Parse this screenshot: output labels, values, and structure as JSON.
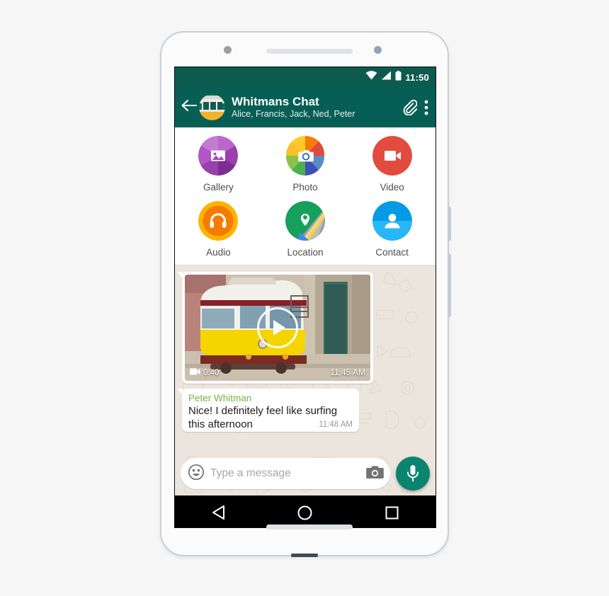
{
  "page": {
    "background_color": "#f6f6f6"
  },
  "phone": {
    "frame_color": "#fbfbfc",
    "border_color": "#c8d0d6",
    "sensor_icon": "proximity-sensor-dot",
    "earpiece_icon": "earpiece-speaker-grille",
    "camera_icon": "front-camera-lens",
    "bottom_speaker_icon": "bottom-speaker-grille",
    "usb_icon": "usb-port",
    "power_button_label": "power-button",
    "volume_button_label": "volume-button"
  },
  "status_bar": {
    "background_color": "#0d5b4e",
    "wifi_icon": "wifi-icon",
    "signal_icon": "cellular-signal-icon",
    "battery_icon": "battery-icon",
    "clock": "11:50"
  },
  "header": {
    "background_color": "#075e54",
    "back_icon": "back-arrow-icon",
    "avatar_icon": "group-avatar",
    "title": "Whitmans Chat",
    "subtitle": "Alice, Francis, Jack, Ned, Peter",
    "attach_icon": "paperclip-icon",
    "overflow_icon": "overflow-menu-icon"
  },
  "attachment_panel": {
    "background_color": "#ffffff",
    "items": [
      {
        "label": "Gallery",
        "icon": "gallery-icon",
        "color": "#ab47bc"
      },
      {
        "label": "Photo",
        "icon": "camera-icon",
        "color": "#f4511e"
      },
      {
        "label": "Video",
        "icon": "video-icon",
        "color": "#e53935"
      },
      {
        "label": "Audio",
        "icon": "headphones-icon",
        "color": "#fb8c00"
      },
      {
        "label": "Location",
        "icon": "map-pin-icon",
        "color": "#15a05a"
      },
      {
        "label": "Contact",
        "icon": "contact-icon",
        "color": "#29b6f6"
      }
    ]
  },
  "chat": {
    "wallpaper_color": "#ece5dd",
    "messages": [
      {
        "type": "video",
        "thumbnail_icon": "tram-video-thumbnail",
        "play_icon": "play-button-icon",
        "duration_icon": "video-camera-icon",
        "duration": "0:40",
        "time": "11:45 AM"
      },
      {
        "type": "text",
        "sender": "Peter Whitman",
        "sender_color": "#7cb342",
        "text": "Nice! I definitely feel like surfing this afternoon",
        "time": "11:48 AM"
      }
    ]
  },
  "input_bar": {
    "emoji_icon": "emoji-smiley-icon",
    "placeholder": "Type a message",
    "value": "",
    "camera_icon": "camera-icon",
    "mic_icon": "microphone-icon",
    "mic_color": "#0b846f"
  },
  "nav_bar": {
    "background_color": "#000000",
    "back_icon": "nav-back-triangle-icon",
    "home_icon": "nav-home-circle-icon",
    "recents_icon": "nav-recents-square-icon"
  }
}
